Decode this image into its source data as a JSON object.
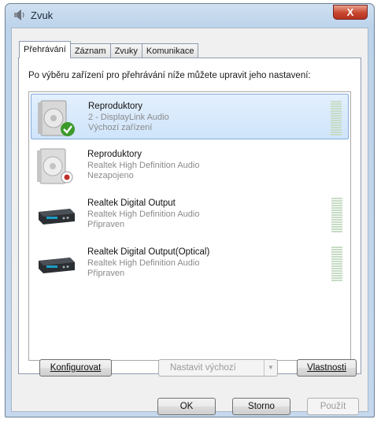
{
  "window": {
    "title": "Zvuk",
    "close_label": "X"
  },
  "tabs": [
    {
      "label": "Přehrávání",
      "active": true
    },
    {
      "label": "Záznam",
      "active": false
    },
    {
      "label": "Zvuky",
      "active": false
    },
    {
      "label": "Komunikace",
      "active": false
    }
  ],
  "instruction": "Po výběru zařízení pro přehrávání níže můžete upravit jeho nastavení:",
  "devices": [
    {
      "name": "Reproduktory",
      "driver": "2 - DisplayLink Audio",
      "status": "Výchozí zařízení",
      "icon": "speaker-icon",
      "badge": "default-check",
      "selected": true
    },
    {
      "name": "Reproduktory",
      "driver": "Realtek High Definition Audio",
      "status": "Nezapojeno",
      "icon": "speaker-icon",
      "badge": "unplugged",
      "selected": false
    },
    {
      "name": "Realtek Digital Output",
      "driver": "Realtek High Definition Audio",
      "status": "Připraven",
      "icon": "digital-output-icon",
      "selected": false
    },
    {
      "name": "Realtek Digital Output(Optical)",
      "driver": "Realtek High Definition Audio",
      "status": "Připraven",
      "icon": "digital-output-icon",
      "selected": false
    }
  ],
  "buttons": {
    "configure": "Konfigurovat",
    "set_default": "Nastavit výchozí",
    "properties": "Vlastnosti",
    "ok": "OK",
    "cancel": "Storno",
    "apply": "Použít"
  },
  "colors": {
    "selection_bg": "#cfe4fb",
    "selection_border": "#84acdd",
    "check_green": "#3c9a2b",
    "unplugged_red": "#c0302a",
    "close_red": "#c8452e"
  }
}
